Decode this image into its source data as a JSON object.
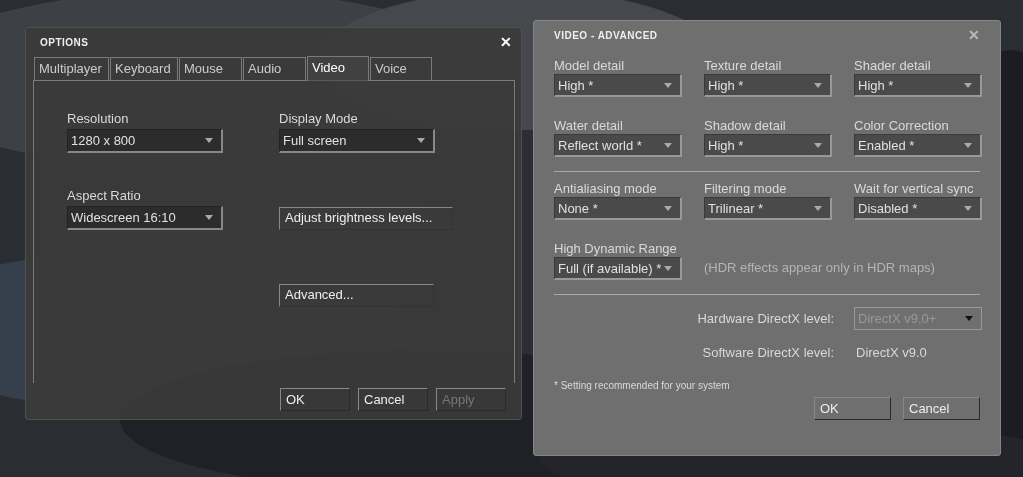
{
  "options_dialog": {
    "title": "OPTIONS",
    "close": "✕",
    "tabs": [
      {
        "label": "Multiplayer",
        "selected": false
      },
      {
        "label": "Keyboard",
        "selected": false
      },
      {
        "label": "Mouse",
        "selected": false
      },
      {
        "label": "Audio",
        "selected": false
      },
      {
        "label": "Video",
        "selected": true
      },
      {
        "label": "Voice",
        "selected": false
      }
    ],
    "rows": [
      {
        "left": {
          "kind": "dropdown",
          "label": "Resolution",
          "value": "1280 x 800"
        },
        "right": {
          "kind": "dropdown",
          "label": "Display Mode",
          "value": "Full screen"
        }
      },
      {
        "left": {
          "kind": "dropdown",
          "label": "Aspect Ratio",
          "value": "Widescreen 16:10"
        },
        "right": {
          "kind": "button",
          "label": "Adjust brightness levels..."
        }
      },
      {
        "right": {
          "kind": "button",
          "label": "Advanced..."
        }
      }
    ],
    "buttons": [
      {
        "label": "OK",
        "disabled": false
      },
      {
        "label": "Cancel",
        "disabled": false
      },
      {
        "label": "Apply",
        "disabled": true
      }
    ]
  },
  "advanced_dialog": {
    "title": "VIDEO - ADVANCED",
    "close": "✕",
    "groups": [
      {
        "items": [
          {
            "kind": "dropdown",
            "label": "Model detail",
            "value": "High *"
          },
          {
            "kind": "dropdown",
            "label": "Texture detail",
            "value": "High *"
          },
          {
            "kind": "dropdown",
            "label": "Shader detail",
            "value": "High *"
          },
          {
            "kind": "dropdown",
            "label": "Water detail",
            "value": "Reflect world *"
          },
          {
            "kind": "dropdown",
            "label": "Shadow detail",
            "value": "High *"
          },
          {
            "kind": "dropdown",
            "label": "Color Correction",
            "value": "Enabled *"
          }
        ]
      },
      {
        "items": [
          {
            "kind": "dropdown",
            "label": "Antialiasing mode",
            "value": "None *"
          },
          {
            "kind": "dropdown",
            "label": "Filtering mode",
            "value": "Trilinear *"
          },
          {
            "kind": "dropdown",
            "label": "Wait for vertical sync",
            "value": "Disabled *"
          },
          {
            "kind": "dropdown",
            "label": "High Dynamic Range",
            "value": "Full (if available) *"
          },
          {
            "kind": "note",
            "text": "(HDR effects appear only in HDR maps)"
          }
        ]
      }
    ],
    "directx": [
      {
        "kind": "dropdown",
        "label": "Hardware DirectX level:",
        "value": "DirectX v9.0+",
        "disabled": true
      },
      {
        "kind": "text",
        "label": "Software DirectX level:",
        "value": "DirectX v9.0"
      }
    ],
    "footnote": "* Setting recommended for your system",
    "buttons": [
      {
        "label": "OK",
        "disabled": false
      },
      {
        "label": "Cancel",
        "disabled": false
      }
    ]
  }
}
